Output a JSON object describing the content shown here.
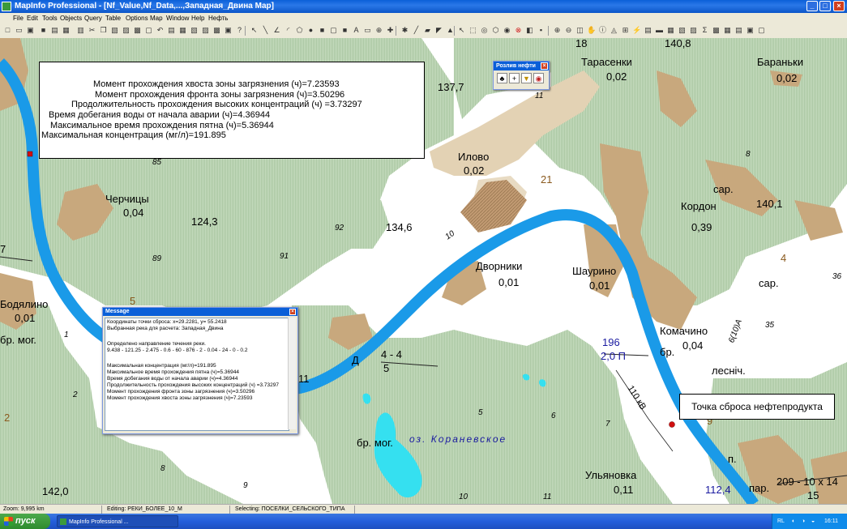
{
  "app": {
    "title": "MapInfo Professional - [Nf_Value,Nf_Data,...,Западная_Двина Map]",
    "window_buttons": [
      "_",
      "□",
      "×"
    ]
  },
  "menu": [
    "File",
    "Edit",
    "Tools",
    "Objects",
    "Query",
    "Table",
    "Options",
    "Map",
    "Window",
    "Help",
    "Нефть"
  ],
  "info_box": {
    "lines": [
      "Момент прохождения хвоста зоны загрязнения (ч)=7.23593",
      "Момент прохождения фронта зоны загрязнения (ч)=3.50296",
      "Продолжительность прохождения высоких концентраций (ч) =3.73297",
      "Время добегания воды от начала аварии (ч)=4.36944",
      "Максимальное время прохождения пятна (ч)=5.36944",
      "Максимальная концентрация (мг/л)=191.895"
    ]
  },
  "palette": {
    "title": "Розлив нефти"
  },
  "message": {
    "title": "Message",
    "lines": [
      "Координаты точки сброса: x=29.2281, y= 55.2418",
      "Выбранная река для расчета: Западная_Двина",
      "",
      "Определено направление течения реки.",
      "9.438 - 121.25 - 2.475 - 0.6 - 60 - 876 - 2 - 0.04 - 24 - 0 - 0.2",
      "",
      "Максимальная концентрация (мг/л)=191.895",
      "Максимальное время прохождения пятна (ч)=5.36944",
      "Время добегания воды от начала аварии (ч)=4.36944",
      "Продолжительность прохождения высоких концентраций (ч) =3.73297",
      "Момент прохождения фронта зоны загрязнения (ч)=3.50296",
      "Момент прохождения хвоста зоны загрязнения (ч)=7.23593"
    ]
  },
  "callout": "Точка сброса нефтепродукта",
  "map_labels": {
    "l18": "18",
    "l140_8": "140,8",
    "tarasenki": "Тарасенки",
    "tarasenki_v": "0,02",
    "baranki": "Бараньки",
    "baranki_v": "0,02",
    "l137_7": "137,7",
    "l11a": "11",
    "ilovo": "Илово",
    "ilovo_v": "0,02",
    "l21": "21",
    "l85": "85",
    "l8a": "8",
    "cherchicy": "Черчицы",
    "cherchicy_v": "0,04",
    "l124_3": "124,3",
    "l92": "92",
    "l134_6": "134,6",
    "l10a": "10",
    "kordon": "Кордон",
    "kordon_v": "0,39",
    "sar1": "сар.",
    "l140_1": "140,1",
    "l89": "89",
    "l91": "91",
    "l7a": "7",
    "dvorniki": "Дворники",
    "dvorniki_v": "0,01",
    "shaurino": "Шаурино",
    "shaurino_v": "0,01",
    "l4a": "4",
    "sar2": "сар.",
    "l36": "36",
    "l5a": "5",
    "bodyalino": "Бодялино",
    "bodyalino_v": "0,01",
    "brmog1": "бр. мог.",
    "l1a": "1",
    "l2a": "2",
    "l196": "196",
    "l2_0p": "2,0 П",
    "komachino": "Комачино",
    "komachino_v": "0,04",
    "br": "бр.",
    "l6_10a": "6(10)А",
    "l35": "35",
    "lesnich": "лесніч.",
    "l110kv": "110 кВ",
    "d": "Д",
    "l4_4": "4 - 4",
    "l5b": "5",
    "l11b": "11",
    "l2b": "2",
    "l5c": "5",
    "l6a": "6",
    "l7b": "7",
    "brmog2": "бр. мог.",
    "lake": "оз. Кораневское",
    "l8b": "8",
    "l9a": "9",
    "l9b": "9",
    "ulyanovka": "Ульяновка",
    "ulyanovka_v": "0,11",
    "l142_0": "142,0",
    "l10b": "10",
    "l11c": "11",
    "l112_4": "112,4",
    "l209": "209 - 10 x 14",
    "l15": "15",
    "par1": "пар.",
    "par2": "п."
  },
  "status": {
    "zoom": "Zoom: 9,995 km",
    "editing": "Editing: РЕКИ_БОЛЕЕ_10_М",
    "selecting": "Selecting: ПОСЕЛКИ_СЕЛЬСКОГО_ТИПА"
  },
  "taskbar": {
    "start": "пуск",
    "task": "MapInfo Professional ...",
    "lang": "RL",
    "time": "16:11"
  },
  "colors": {
    "forest": "#b9d3b0",
    "settlement": "#c8a87d",
    "river": "#1a9ae8",
    "lake": "#35e0f0",
    "sand": "#e3d2b4"
  }
}
